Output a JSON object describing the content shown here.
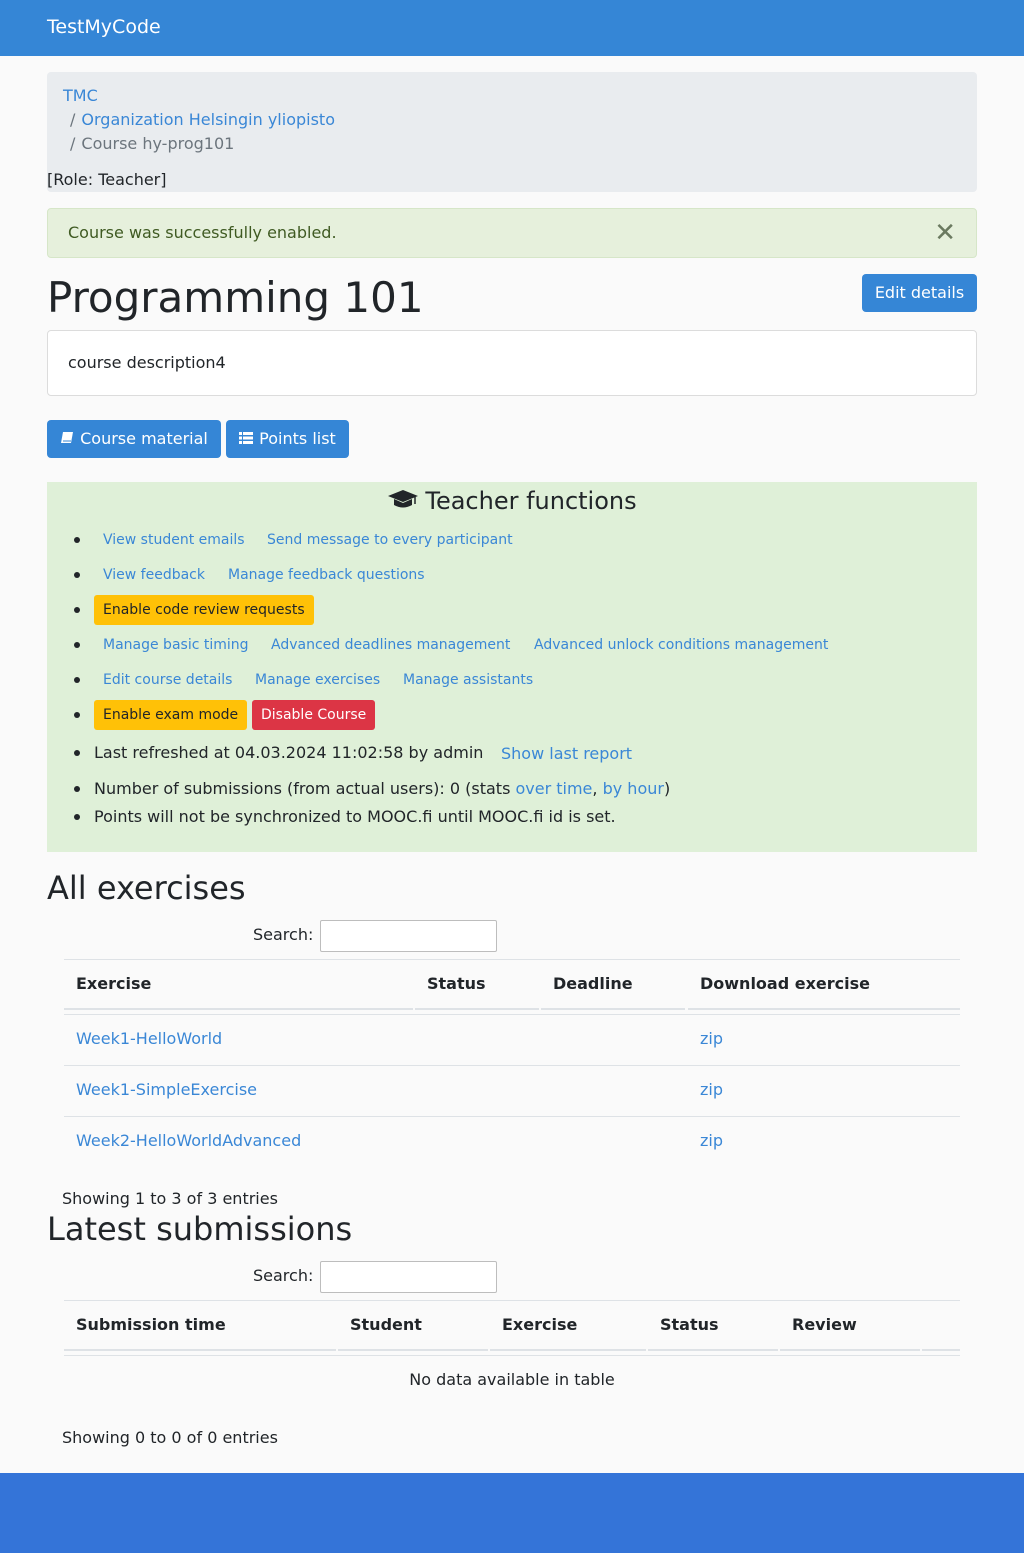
{
  "navbar": {
    "brand": "TestMyCode"
  },
  "breadcrumb": {
    "items": [
      "TMC",
      "Organization Helsingin yliopisto",
      "Course hy-prog101"
    ],
    "separator": "/",
    "role": "[Role: Teacher]"
  },
  "alert": {
    "message": "Course was successfully enabled.",
    "close": "✕"
  },
  "course": {
    "title": "Programming 101",
    "edit_label": "Edit details",
    "description": "course description4",
    "material_label": "Course material",
    "points_label": "Points list"
  },
  "teacher": {
    "heading": "Teacher functions",
    "row1": [
      "View student emails",
      "Send message to every participant"
    ],
    "row2": [
      "View feedback",
      "Manage feedback questions"
    ],
    "row3": [
      "Enable code review requests"
    ],
    "row4": [
      "Manage basic timing",
      "Advanced deadlines management",
      "Advanced unlock conditions management"
    ],
    "row5": [
      "Edit course details",
      "Manage exercises",
      "Manage assistants"
    ],
    "row6": {
      "exam": "Enable exam mode",
      "disable": "Disable Course"
    },
    "refresh": {
      "text": "Last refreshed at 04.03.2024 11:02:58 by admin",
      "link": "Show last report"
    },
    "submissions": {
      "prefix": "Number of submissions (from actual users): 0 (stats ",
      "link1": "over time",
      "sep": ",",
      "link2": "by hour",
      "suffix": ")"
    },
    "mooc": "Points will not be synchronized to MOOC.fi until MOOC.fi id is set."
  },
  "exercises": {
    "title": "All exercises",
    "search_label": "Search:",
    "columns": [
      "Exercise",
      "Status",
      "Deadline",
      "Download exercise"
    ],
    "rows": [
      {
        "name": "Week1-HelloWorld",
        "status": "",
        "deadline": "",
        "download": "zip"
      },
      {
        "name": "Week1-SimpleExercise",
        "status": "",
        "deadline": "",
        "download": "zip"
      },
      {
        "name": "Week2-HelloWorldAdvanced",
        "status": "",
        "deadline": "",
        "download": "zip"
      }
    ],
    "info": "Showing 1 to 3 of 3 entries"
  },
  "submissions_table": {
    "title": "Latest submissions",
    "search_label": "Search:",
    "columns": [
      "Submission time",
      "Student",
      "Exercise",
      "Status",
      "Review"
    ],
    "empty": "No data available in table",
    "info": "Showing 0 to 0 of 0 entries"
  },
  "colors": {
    "navbar": "#3586d6",
    "primary": "#3586d6",
    "teacher_bg": "#dff0d8",
    "warning": "#ffc107",
    "danger": "#dc3545",
    "link": "#3a87d6",
    "footer": "#3474d8"
  }
}
